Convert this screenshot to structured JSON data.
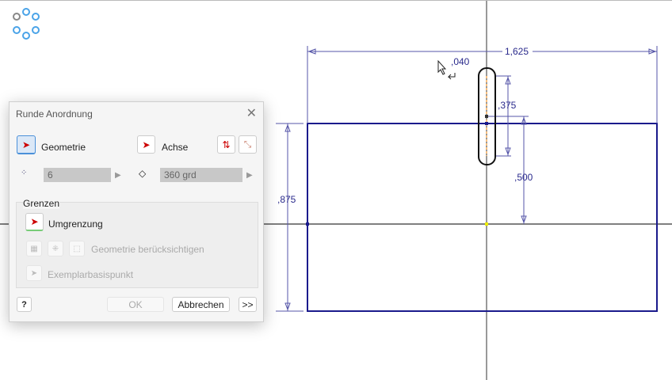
{
  "drawing": {
    "dim_width": "1,625",
    "dim_radius": ",040",
    "dim_slot": ",375",
    "dim_offset": ",500",
    "dim_height": ",875"
  },
  "dialog": {
    "title": "Runde Anordnung",
    "geometry_label": "Geometrie",
    "axis_label": "Achse",
    "count_value": "6",
    "angle_value": "360 grd",
    "limits_group": "Grenzen",
    "boundary_label": "Umgrenzung",
    "consider_geometry_label": "Geometrie berücksichtigen",
    "base_point_label": "Exemplarbasispunkt",
    "ok_label": "OK",
    "cancel_label": "Abbrechen",
    "more_label": ">>",
    "help_label": "?"
  }
}
